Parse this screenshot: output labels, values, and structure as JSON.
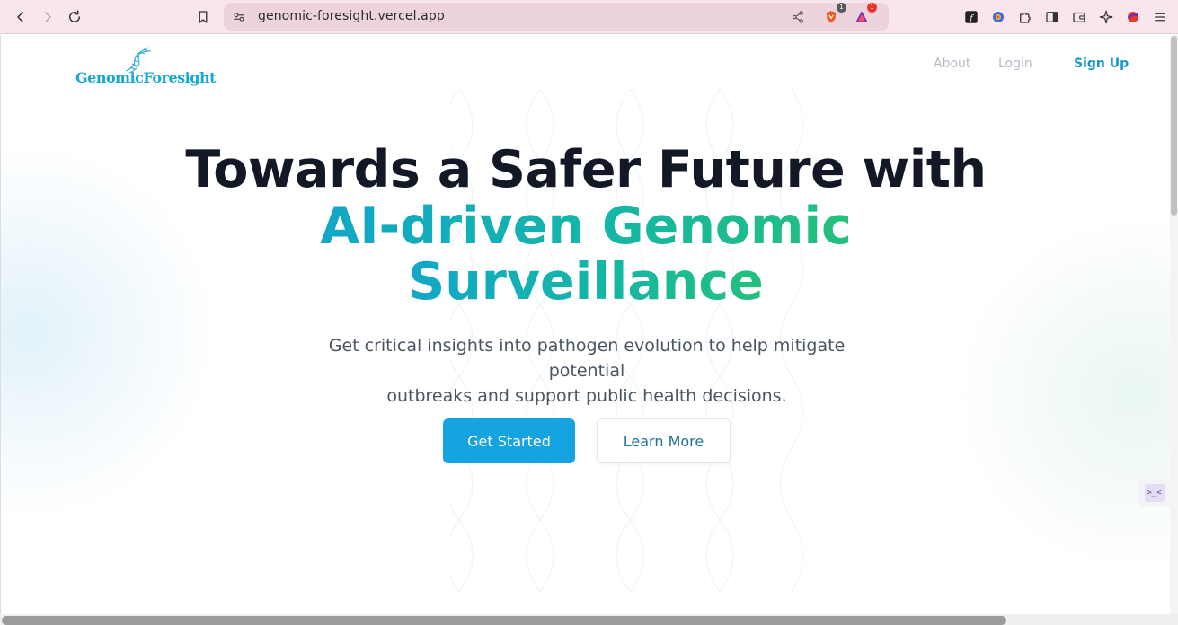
{
  "browser": {
    "url": "genomic-foresight.vercel.app",
    "brave_badge": "1",
    "rewards_badge": "1"
  },
  "site": {
    "logo_text": "GenomicForesight",
    "nav": {
      "about": "About",
      "login": "Login",
      "signup": "Sign Up"
    }
  },
  "hero": {
    "line1": "Towards a Safer Future with",
    "line2a": "AI-driven Genomic",
    "line2b": "Surveillance",
    "subtitle_line1": "Get critical insights into pathogen evolution to help mitigate potential",
    "subtitle_line2": "outbreaks and support public health decisions.",
    "primary_button": "Get Started",
    "secondary_button": "Learn More"
  },
  "widget": {
    "label": ">_<"
  },
  "colors": {
    "brand": "#18a7d4",
    "primary_button": "#16a3e2",
    "gradient_start": "#12a7c7",
    "gradient_end": "#24c07a",
    "heading": "#121826",
    "chrome_bg": "#f9e6ec"
  }
}
